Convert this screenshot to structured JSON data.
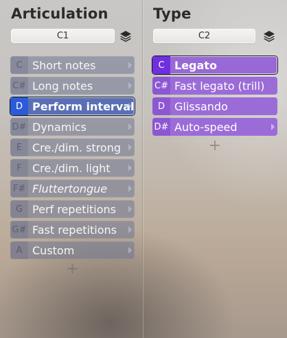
{
  "articulation": {
    "title": "Articulation",
    "selector_value": "C1",
    "items": [
      {
        "key": "C",
        "label": "Short notes",
        "active": false,
        "italic": false
      },
      {
        "key": "C#",
        "label": "Long notes",
        "active": false,
        "italic": false
      },
      {
        "key": "D",
        "label": "Perform interval",
        "active": true,
        "italic": false
      },
      {
        "key": "D#",
        "label": "Dynamics",
        "active": false,
        "italic": false
      },
      {
        "key": "E",
        "label": "Cre./dim. strong",
        "active": false,
        "italic": false
      },
      {
        "key": "F",
        "label": "Cre./dim. light",
        "active": false,
        "italic": false
      },
      {
        "key": "F#",
        "label": "Fluttertongue",
        "active": false,
        "italic": true
      },
      {
        "key": "G",
        "label": "Perf repetitions",
        "active": false,
        "italic": false
      },
      {
        "key": "G#",
        "label": "Fast repetitions",
        "active": false,
        "italic": false
      },
      {
        "key": "A",
        "label": "Custom",
        "active": false,
        "italic": false
      }
    ],
    "add_symbol": "+"
  },
  "type": {
    "title": "Type",
    "selector_value": "C2",
    "items": [
      {
        "key": "C",
        "label": "Legato",
        "active": true
      },
      {
        "key": "C#",
        "label": "Fast legato (trill)",
        "active": false
      },
      {
        "key": "D",
        "label": "Glissando",
        "active": false
      },
      {
        "key": "D#",
        "label": "Auto-speed",
        "active": false
      }
    ],
    "add_symbol": "+"
  },
  "icons": {
    "layers": "layers-icon",
    "submenu": "chevron-right-icon",
    "add": "plus-icon"
  },
  "colors": {
    "articulation_item_bg": "#70768f",
    "articulation_active_key": "#2b5bd9",
    "type_item_bg": "#9b6cd8",
    "type_active_key": "#6f2fe0"
  }
}
